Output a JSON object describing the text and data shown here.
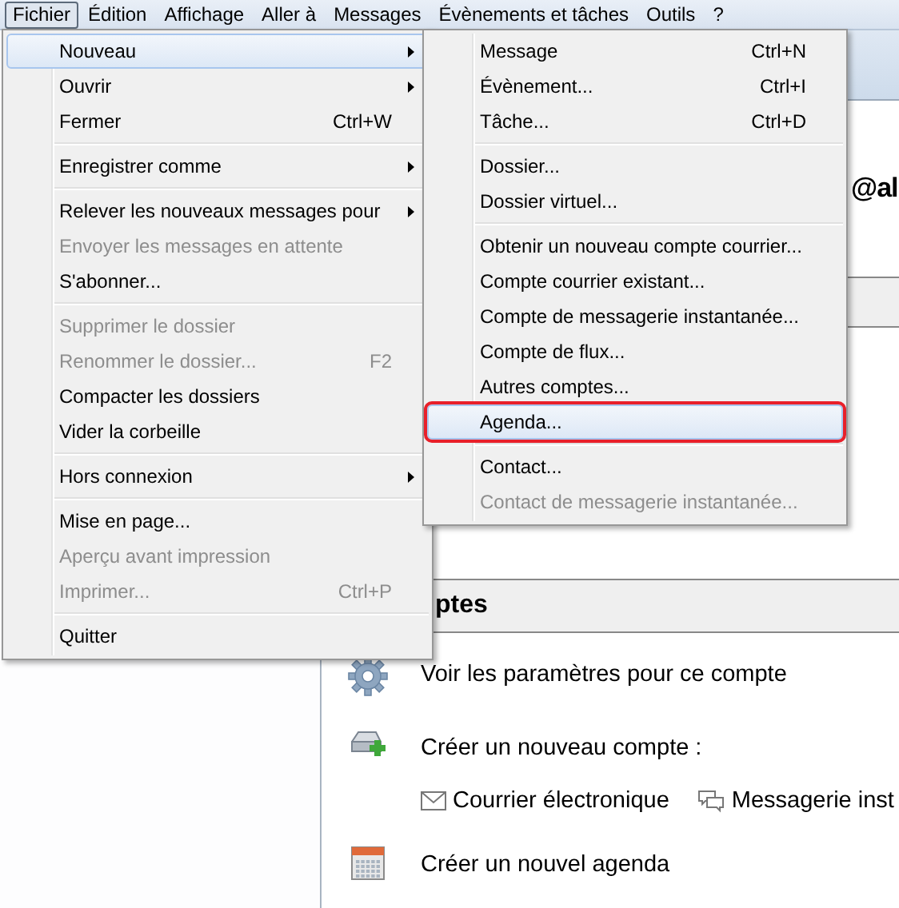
{
  "menubar": [
    {
      "label": "Fichier",
      "selected": true
    },
    {
      "label": "Édition",
      "selected": false
    },
    {
      "label": "Affichage",
      "selected": false
    },
    {
      "label": "Aller à",
      "selected": false
    },
    {
      "label": "Messages",
      "selected": false
    },
    {
      "label": "Évènements et tâches",
      "selected": false
    },
    {
      "label": "Outils",
      "selected": false
    },
    {
      "label": "?",
      "selected": false
    }
  ],
  "file_menu": [
    {
      "kind": "item",
      "label": "Nouveau",
      "submenu": true,
      "disabled": false,
      "selected": true
    },
    {
      "kind": "item",
      "label": "Ouvrir",
      "submenu": true,
      "disabled": false,
      "selected": false
    },
    {
      "kind": "item",
      "label": "Fermer",
      "shortcut": "Ctrl+W",
      "submenu": false,
      "disabled": false,
      "selected": false
    },
    {
      "kind": "separator"
    },
    {
      "kind": "item",
      "label": "Enregistrer comme",
      "submenu": true,
      "disabled": false,
      "selected": false
    },
    {
      "kind": "separator"
    },
    {
      "kind": "item",
      "label": "Relever les nouveaux messages pour",
      "submenu": true,
      "disabled": false,
      "selected": false
    },
    {
      "kind": "item",
      "label": "Envoyer les messages en attente",
      "submenu": false,
      "disabled": true,
      "selected": false
    },
    {
      "kind": "item",
      "label": "S'abonner...",
      "submenu": false,
      "disabled": false,
      "selected": false
    },
    {
      "kind": "separator"
    },
    {
      "kind": "item",
      "label": "Supprimer le dossier",
      "submenu": false,
      "disabled": true,
      "selected": false
    },
    {
      "kind": "item",
      "label": "Renommer le dossier...",
      "shortcut": "F2",
      "submenu": false,
      "disabled": true,
      "selected": false
    },
    {
      "kind": "item",
      "label": "Compacter les dossiers",
      "submenu": false,
      "disabled": false,
      "selected": false
    },
    {
      "kind": "item",
      "label": "Vider la corbeille",
      "submenu": false,
      "disabled": false,
      "selected": false
    },
    {
      "kind": "separator"
    },
    {
      "kind": "item",
      "label": "Hors connexion",
      "submenu": true,
      "disabled": false,
      "selected": false
    },
    {
      "kind": "separator"
    },
    {
      "kind": "item",
      "label": "Mise en page...",
      "submenu": false,
      "disabled": false,
      "selected": false
    },
    {
      "kind": "item",
      "label": "Aperçu avant impression",
      "submenu": false,
      "disabled": true,
      "selected": false
    },
    {
      "kind": "item",
      "label": "Imprimer...",
      "shortcut": "Ctrl+P",
      "submenu": false,
      "disabled": true,
      "selected": false
    },
    {
      "kind": "separator"
    },
    {
      "kind": "item",
      "label": "Quitter",
      "submenu": false,
      "disabled": false,
      "selected": false
    }
  ],
  "new_submenu": [
    {
      "kind": "item",
      "label": "Message",
      "shortcut": "Ctrl+N",
      "disabled": false,
      "selected": false,
      "outlined": false
    },
    {
      "kind": "item",
      "label": "Évènement...",
      "shortcut": "Ctrl+I",
      "disabled": false,
      "selected": false,
      "outlined": false
    },
    {
      "kind": "item",
      "label": "Tâche...",
      "shortcut": "Ctrl+D",
      "disabled": false,
      "selected": false,
      "outlined": false
    },
    {
      "kind": "separator"
    },
    {
      "kind": "item",
      "label": "Dossier...",
      "disabled": false,
      "selected": false,
      "outlined": false
    },
    {
      "kind": "item",
      "label": "Dossier virtuel...",
      "disabled": false,
      "selected": false,
      "outlined": false
    },
    {
      "kind": "separator"
    },
    {
      "kind": "item",
      "label": "Obtenir un nouveau compte courrier...",
      "disabled": false,
      "selected": false,
      "outlined": false
    },
    {
      "kind": "item",
      "label": "Compte courrier existant...",
      "disabled": false,
      "selected": false,
      "outlined": false
    },
    {
      "kind": "item",
      "label": "Compte de messagerie instantanée...",
      "disabled": false,
      "selected": false,
      "outlined": false
    },
    {
      "kind": "item",
      "label": "Compte de flux...",
      "disabled": false,
      "selected": false,
      "outlined": false
    },
    {
      "kind": "item",
      "label": "Autres comptes...",
      "disabled": false,
      "selected": false,
      "outlined": false
    },
    {
      "kind": "item",
      "label": "Agenda...",
      "disabled": false,
      "selected": true,
      "outlined": true
    },
    {
      "kind": "separator"
    },
    {
      "kind": "item",
      "label": "Contact...",
      "disabled": false,
      "selected": false,
      "outlined": false
    },
    {
      "kind": "item",
      "label": "Contact de messagerie instantanée...",
      "disabled": true,
      "selected": false,
      "outlined": false
    }
  ],
  "account_page": {
    "title": "@al",
    "section_title": "ptes",
    "actions": [
      {
        "kind": "settings",
        "label": "Voir les paramètres pour ce compte"
      },
      {
        "kind": "new-account",
        "label": "Créer un nouveau compte :",
        "links": [
          {
            "kind": "mail",
            "label": "Courrier électronique"
          },
          {
            "kind": "chat",
            "label": "Messagerie inst"
          }
        ]
      },
      {
        "kind": "calendar",
        "label": "Créer un nouvel agenda"
      }
    ]
  }
}
